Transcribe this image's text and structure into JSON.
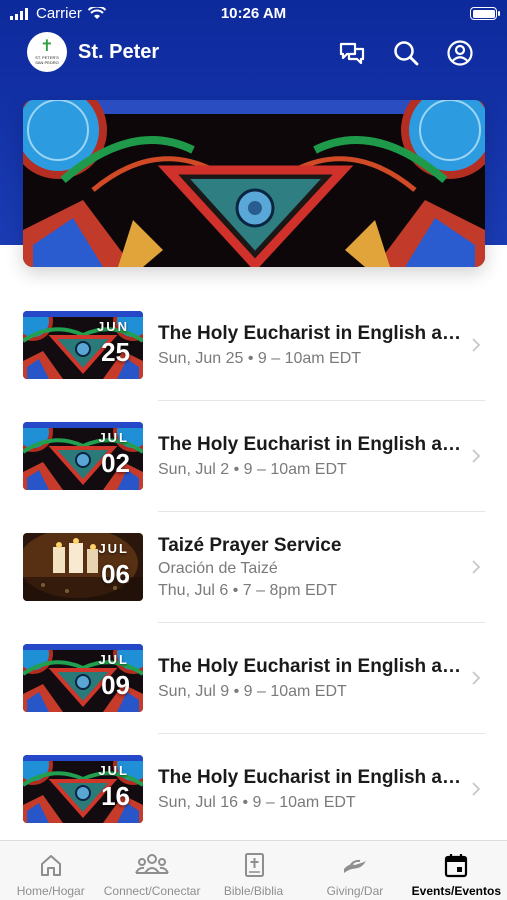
{
  "status_bar": {
    "carrier": "Carrier",
    "time": "10:26 AM"
  },
  "header": {
    "title": "St. Peter",
    "logo_text": "ST. PETER'S SAN PEDRO",
    "icons": [
      "chat-bubbles-icon",
      "search-icon",
      "profile-icon"
    ]
  },
  "events": [
    {
      "month": "JUN",
      "day": "25",
      "title": "The Holy Eucharist in English and Spanish",
      "subtitle": "",
      "time": "Sun, Jun 25 • 9 – 10am EDT",
      "image": "stained-glass"
    },
    {
      "month": "JUL",
      "day": "02",
      "title": "The Holy Eucharist in English and Spanish",
      "subtitle": "",
      "time": "Sun, Jul 2 • 9 – 10am EDT",
      "image": "stained-glass"
    },
    {
      "month": "JUL",
      "day": "06",
      "title": "Taizé Prayer Service",
      "subtitle": "Oración de Taizé",
      "time": "Thu, Jul 6 • 7 – 8pm EDT",
      "image": "candles"
    },
    {
      "month": "JUL",
      "day": "09",
      "title": "The Holy Eucharist in English and Spanish",
      "subtitle": "",
      "time": "Sun, Jul 9 • 9 – 10am EDT",
      "image": "stained-glass"
    },
    {
      "month": "JUL",
      "day": "16",
      "title": "The Holy Eucharist in English and Spanish",
      "subtitle": "",
      "time": "Sun, Jul 16 • 9 – 10am EDT",
      "image": "stained-glass"
    }
  ],
  "tabs": [
    {
      "label": "Home/Hogar",
      "icon": "home-icon",
      "active": false
    },
    {
      "label": "Connect/Conectar",
      "icon": "people-icon",
      "active": false
    },
    {
      "label": "Bible/Biblia",
      "icon": "bible-icon",
      "active": false
    },
    {
      "label": "Giving/Dar",
      "icon": "giving-hand-icon",
      "active": false
    },
    {
      "label": "Events/Eventos",
      "icon": "calendar-icon",
      "active": true
    }
  ],
  "colors": {
    "header_blue": "#1a3bb3",
    "text_dark": "#1a1a1a",
    "text_muted": "#7a7a7a",
    "tab_inactive": "#8e8e8e"
  }
}
